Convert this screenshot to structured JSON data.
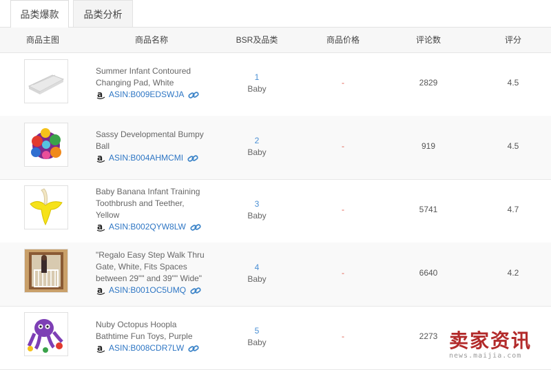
{
  "tabs": [
    {
      "label": "品类爆款",
      "active": true
    },
    {
      "label": "品类分析",
      "active": false
    }
  ],
  "columns": [
    "商品主图",
    "商品名称",
    "BSR及品类",
    "商品价格",
    "评论数",
    "评分"
  ],
  "products": [
    {
      "name_lines": [
        "Summer Infant Contoured",
        "Changing Pad, White"
      ],
      "asin": "ASIN:B009EDSWJA",
      "rank": "1",
      "category": "Baby",
      "price": "-",
      "reviews": "2829",
      "rating": "4.5",
      "image_icon": "changing-pad-image"
    },
    {
      "name_lines": [
        "Sassy Developmental Bumpy",
        "Ball"
      ],
      "asin": "ASIN:B004AHMCMI",
      "rank": "2",
      "category": "Baby",
      "price": "-",
      "reviews": "919",
      "rating": "4.5",
      "image_icon": "bumpy-ball-image"
    },
    {
      "name_lines": [
        "Baby Banana Infant Training",
        "Toothbrush and Teether,",
        "Yellow"
      ],
      "asin": "ASIN:B002QYW8LW",
      "rank": "3",
      "category": "Baby",
      "price": "-",
      "reviews": "5741",
      "rating": "4.7",
      "image_icon": "banana-toothbrush-image"
    },
    {
      "name_lines": [
        "\"Regalo Easy Step Walk Thru",
        "Gate, White, Fits Spaces",
        "between 29\"\" and 39\"\" Wide\""
      ],
      "asin": "ASIN:B001OC5UMQ",
      "rank": "4",
      "category": "Baby",
      "price": "-",
      "reviews": "6640",
      "rating": "4.2",
      "image_icon": "baby-gate-image"
    },
    {
      "name_lines": [
        "Nuby Octopus Hoopla",
        "Bathtime Fun Toys, Purple"
      ],
      "asin": "ASIN:B008CDR7LW",
      "rank": "5",
      "category": "Baby",
      "price": "-",
      "reviews": "2273",
      "rating": "",
      "image_icon": "octopus-toy-image"
    }
  ],
  "watermark": {
    "title": "卖家资讯",
    "url": "news.maijia.com"
  },
  "colors": {
    "link": "#2e76c4",
    "rank": "#4a8fd4",
    "price": "#e15b4d",
    "watermark": "#b22a2a"
  }
}
